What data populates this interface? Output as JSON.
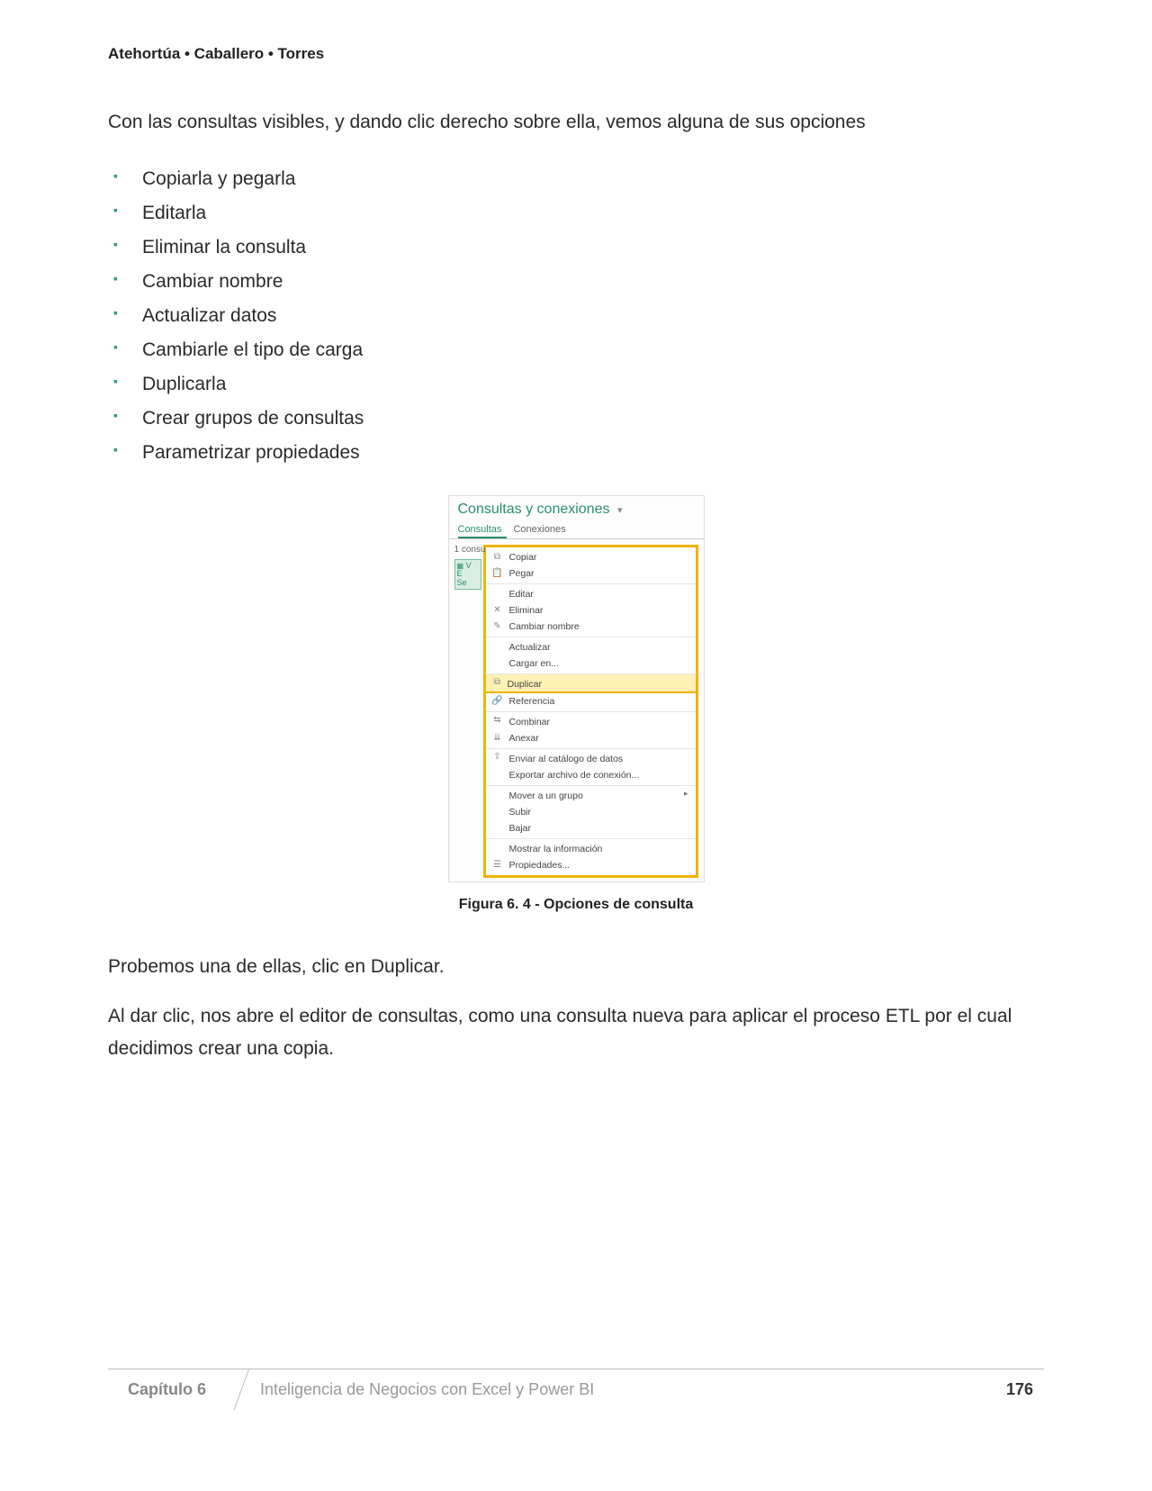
{
  "authors": "Atehortúa • Caballero • Torres",
  "intro": "Con las consultas visibles, y dando clic derecho sobre ella, vemos alguna de sus opciones",
  "options": [
    "Copiarla y pegarla",
    "Editarla",
    "Eliminar la consulta",
    "Cambiar nombre",
    "Actualizar datos",
    "Cambiarle el tipo de carga",
    "Duplicarla",
    "Crear grupos de consultas",
    "Parametrizar propiedades"
  ],
  "panel": {
    "title": "Consultas y conexiones",
    "tabs": {
      "active": "Consultas",
      "other": "Conexiones"
    },
    "count": "1 consu",
    "queryItem": {
      "line1": "V E",
      "line2": "Se"
    },
    "menu": {
      "copiar": "Copiar",
      "pegar": "Pegar",
      "editar": "Editar",
      "eliminar": "Eliminar",
      "cambiar": "Cambiar nombre",
      "actualizar": "Actualizar",
      "cargar": "Cargar en...",
      "duplicar": "Duplicar",
      "referencia": "Referencia",
      "combinar": "Combinar",
      "anexar": "Anexar",
      "enviar": "Enviar al catálogo de datos",
      "exportar": "Exportar archivo de conexión...",
      "mover": "Mover a un grupo",
      "subir": "Subir",
      "bajar": "Bajar",
      "mostrar": "Mostrar la información",
      "propiedades": "Propiedades..."
    }
  },
  "caption": "Figura 6. 4 - Opciones de consulta",
  "para1": "Probemos una de ellas, clic en Duplicar.",
  "para2": "Al dar clic, nos abre el editor de consultas, como una consulta nueva para aplicar el proceso ETL por el cual decidimos crear una copia.",
  "footer": {
    "chapter": "Capítulo 6",
    "title": "Inteligencia de Negocios con Excel y Power BI",
    "page": "176"
  }
}
